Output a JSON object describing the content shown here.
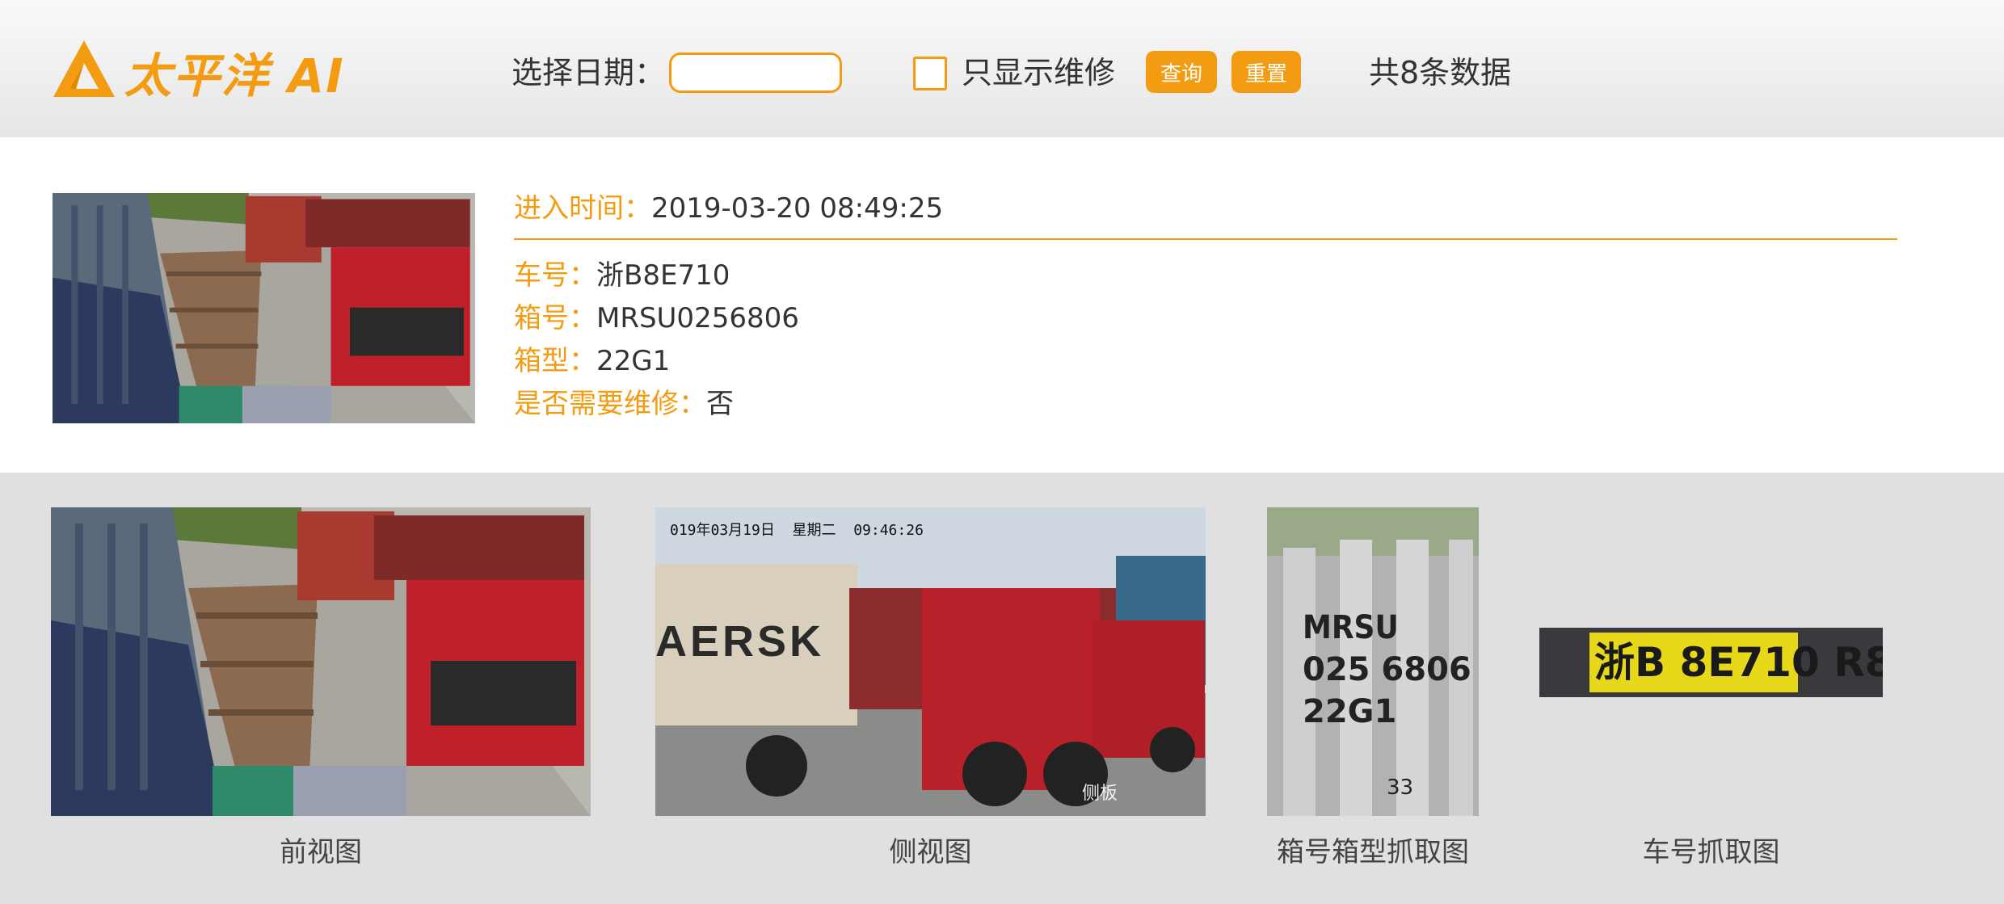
{
  "header": {
    "logo_text": "太平洋 AI",
    "logo_icon": "triangle-logo-icon",
    "date_label": "选择日期：",
    "date_value": "",
    "repair_only_label": "只显示维修",
    "repair_only_checked": false,
    "query_button": "查询",
    "reset_button": "重置",
    "total_count": "共8条数据"
  },
  "record": {
    "entry_time_label": "进入时间：",
    "entry_time": "2019-03-20 08:49:25",
    "plate_label": "车号：",
    "plate": "浙B8E710",
    "box_label": "箱号：",
    "box": "MRSU0256806",
    "type_label": "箱型：",
    "type": "22G1",
    "repair_label": "是否需要维修：",
    "repair": "否"
  },
  "gallery": {
    "front_caption": "前视图",
    "side_caption": "侧视图",
    "box_caption": "箱号箱型抓取图",
    "plate_caption": "车号抓取图",
    "side_timestamp": "019年03月19日  星期二  09:46:26",
    "side_watermark": "侧板",
    "side_container_text": "AERSK",
    "box_crop_text": [
      "MRSU",
      "025 6806",
      "22G1",
      "33"
    ],
    "plate_crop_text": "浙B 8E710 R8"
  },
  "colors": {
    "accent": "#f39c12",
    "text": "#333333",
    "gallery_bg": "#e0e0e0",
    "header_bg": "#eeeeee"
  }
}
